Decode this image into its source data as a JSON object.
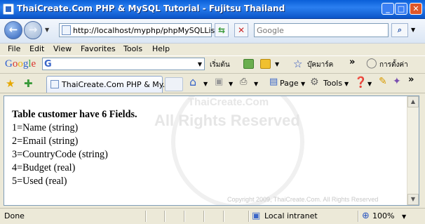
{
  "window": {
    "title": "ThaiCreate.Com PHP & MySQL Tutorial - Fujitsu Thailand"
  },
  "address": {
    "url": "http://localhost/myphp/phpMySQLList"
  },
  "search": {
    "placeholder": "Google"
  },
  "menu": [
    "File",
    "Edit",
    "View",
    "Favorites",
    "Tools",
    "Help"
  ],
  "google_toolbar": {
    "logo": "Google",
    "search_button": "เริ่มต้น",
    "bookmarks": "บุ๊คมาร์ค",
    "settings": "การตั้งค่า"
  },
  "tab": {
    "title": "ThaiCreate.Com PHP & My..."
  },
  "commandbar": {
    "page": "Page",
    "tools": "Tools"
  },
  "content": {
    "heading": "Table customer have 6 Fields.",
    "lines": [
      "1=Name (string)",
      "2=Email (string)",
      "3=CountryCode (string)",
      "4=Budget (real)",
      "5=Used (real)"
    ],
    "watermark_1": "ThaiCreate.Com",
    "watermark_2": "All Rights Reserved",
    "copyright": "Copyright 2009, ThaiCreate.Com. All Rights Reserved"
  },
  "status": {
    "text": "Done",
    "zone": "Local intranet",
    "zoom": "100%"
  },
  "colors": {
    "titlebar": "#0a5fd8",
    "accent": "#2e68c8"
  }
}
